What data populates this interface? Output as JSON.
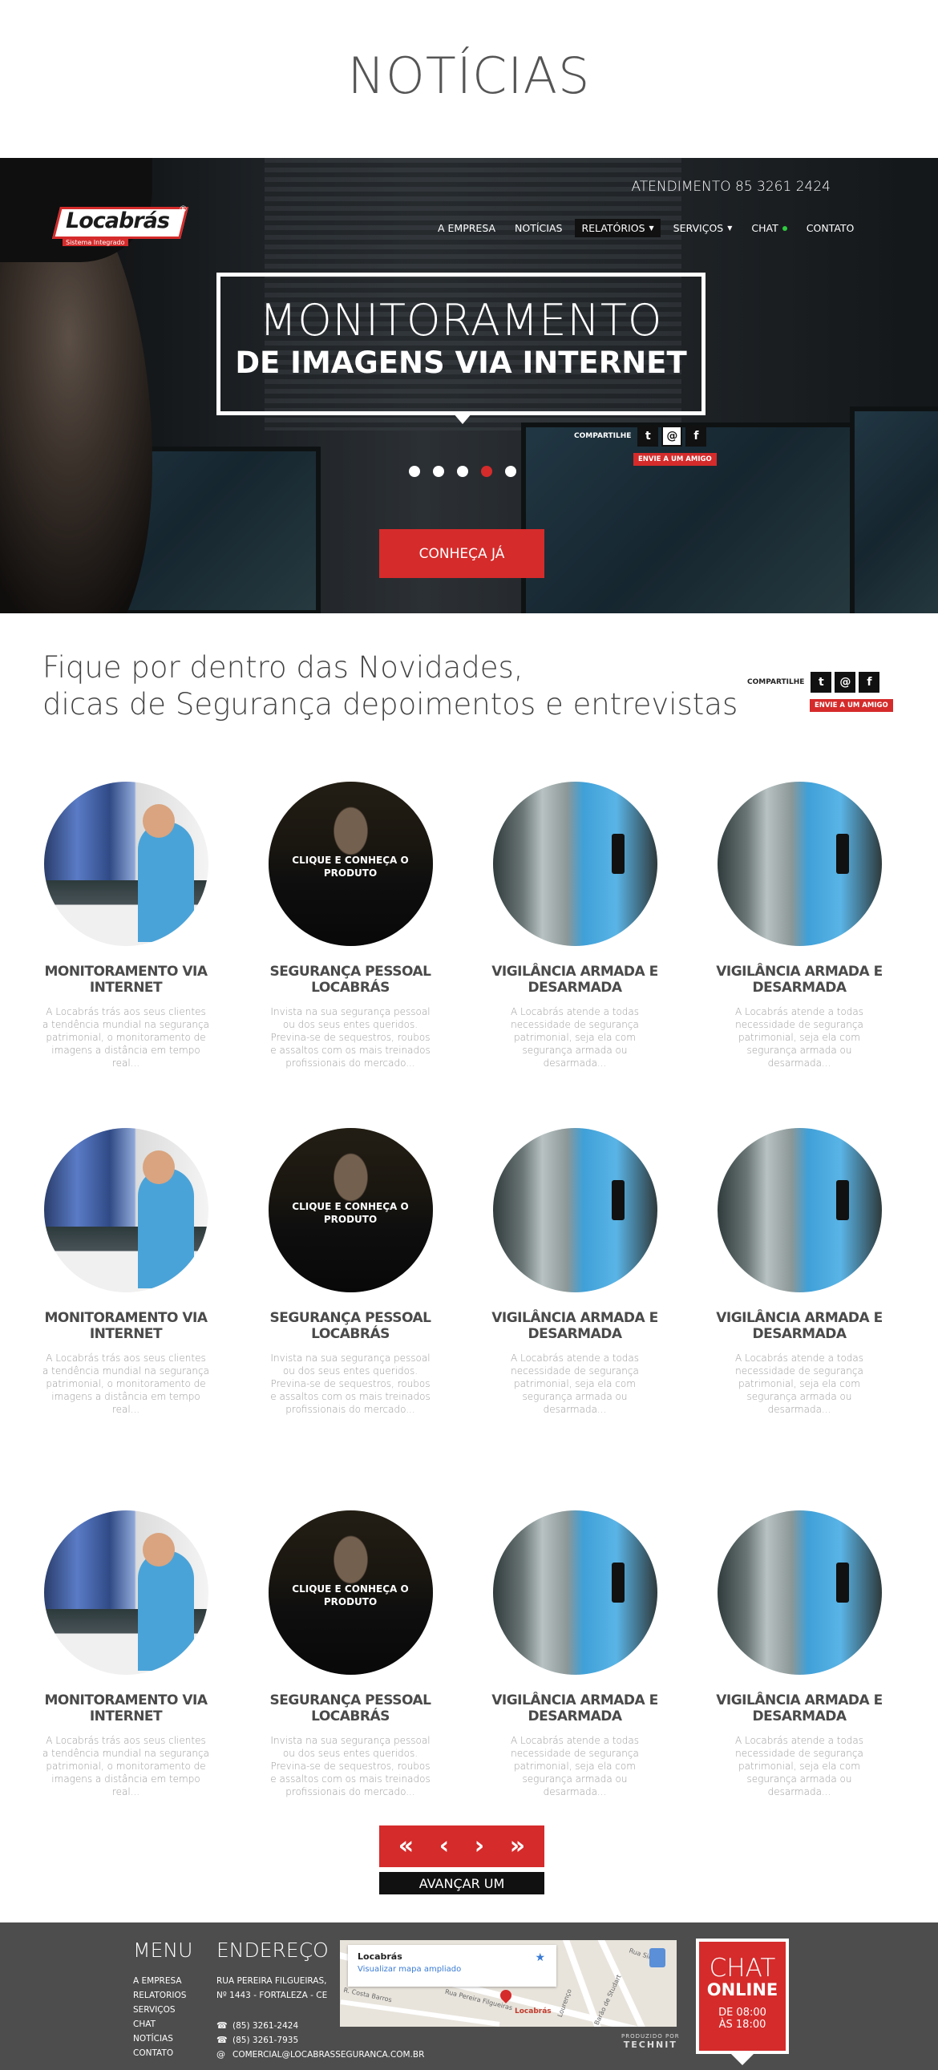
{
  "page_title": "NOTÍCIAS",
  "hero": {
    "phone": "ATENDIMENTO 85 3261 2424",
    "logo": {
      "word": "Locabrás",
      "tagline": "Sistema Integrado",
      "reg": "®"
    },
    "nav": [
      {
        "label": "A EMPRESA",
        "dropdown": false
      },
      {
        "label": "NOTÍCIAS",
        "dropdown": false
      },
      {
        "label": "RELATÓRIOS",
        "dropdown": true
      },
      {
        "label": "SERVIÇOS",
        "dropdown": true
      },
      {
        "label": "CHAT",
        "dropdown": false,
        "status": "online"
      },
      {
        "label": "CONTATO",
        "dropdown": false
      }
    ],
    "headline_line1": "MONITORAMENTO",
    "headline_line2": "DE IMAGENS VIA INTERNET",
    "share_label": "COMPARTILHE",
    "send_friend": "ENVIE A UM AMIGO",
    "slides_total": 5,
    "active_slide": 4,
    "cta": "CONHEÇA JÁ"
  },
  "share_icons": {
    "twitter": "t",
    "email": "@",
    "facebook": "f"
  },
  "intro": {
    "line1": "Fique por dentro das Novidades,",
    "line2": "dicas de Segurança depoimentos e entrevistas",
    "share_label": "COMPARTILHE",
    "send_friend": "ENVIE A UM AMIGO"
  },
  "card_overlay": "CLIQUE E CONHEÇA O PRODUTO",
  "cards": [
    {
      "image": "monitor",
      "title": "MONITORAMENTO VIA INTERNET",
      "desc": "A Locabrás trás aos seus clientes a tendência mundial na segurança patrimonial, o monitoramento de imagens a distância em tempo real..."
    },
    {
      "image": "guard",
      "title": "SEGURANÇA PESSOAL LOCABRÁS",
      "desc": "Invista na sua segurança pessoal ou dos seus entes queridos. Previna-se de sequestros, roubos e assaltos com os mais treinados profissionais do mercado..."
    },
    {
      "image": "armed",
      "title": "VIGILÂNCIA ARMADA E DESARMADA",
      "desc": "A Locabrás atende a todas necessidade de segurança patrimonial, seja ela com segurança armada ou desarmada..."
    },
    {
      "image": "armed",
      "title": "VIGILÂNCIA ARMADA E DESARMADA",
      "desc": "A Locabrás atende a todas necessidade de segurança patrimonial, seja ela com segurança armada ou desarmada..."
    }
  ],
  "pager": {
    "first": "«",
    "prev": "‹",
    "next_arrow": "›",
    "last": "»",
    "next_label": "AVANÇAR UM"
  },
  "footer": {
    "menu_title": "MENU",
    "menu": [
      "A EMPRESA",
      "RELATORIOS",
      "SERVIÇOS",
      "CHAT",
      "NOTÍCIAS",
      "CONTATO"
    ],
    "address_title": "ENDEREÇO",
    "address_line1": "RUA PEREIRA FILGUEIRAS,",
    "address_line2": "Nº 1443 - FORTALEZA - CE",
    "phone1": "(85) 3261-2424",
    "phone2": "(85) 3261-7935",
    "email": "COMERCIAL@LOCABRASSEGURANCA.COM.BR",
    "map": {
      "title": "Locabrás",
      "link": "Visualizar mapa ampliado",
      "pin_label": "Locabrás",
      "streets": [
        "R. Costa Barros",
        "Rua Pereira Filgueiras",
        "Rua Silva",
        "Barão de Studart",
        "Lourenço"
      ]
    },
    "chat": {
      "line1": "CHAT",
      "line2": "ONLINE",
      "hours1": "DE 08:00",
      "hours2": "ÀS 18:00"
    },
    "credit_small": "PRODUZIDO POR",
    "credit_big": "TECHNIT"
  }
}
